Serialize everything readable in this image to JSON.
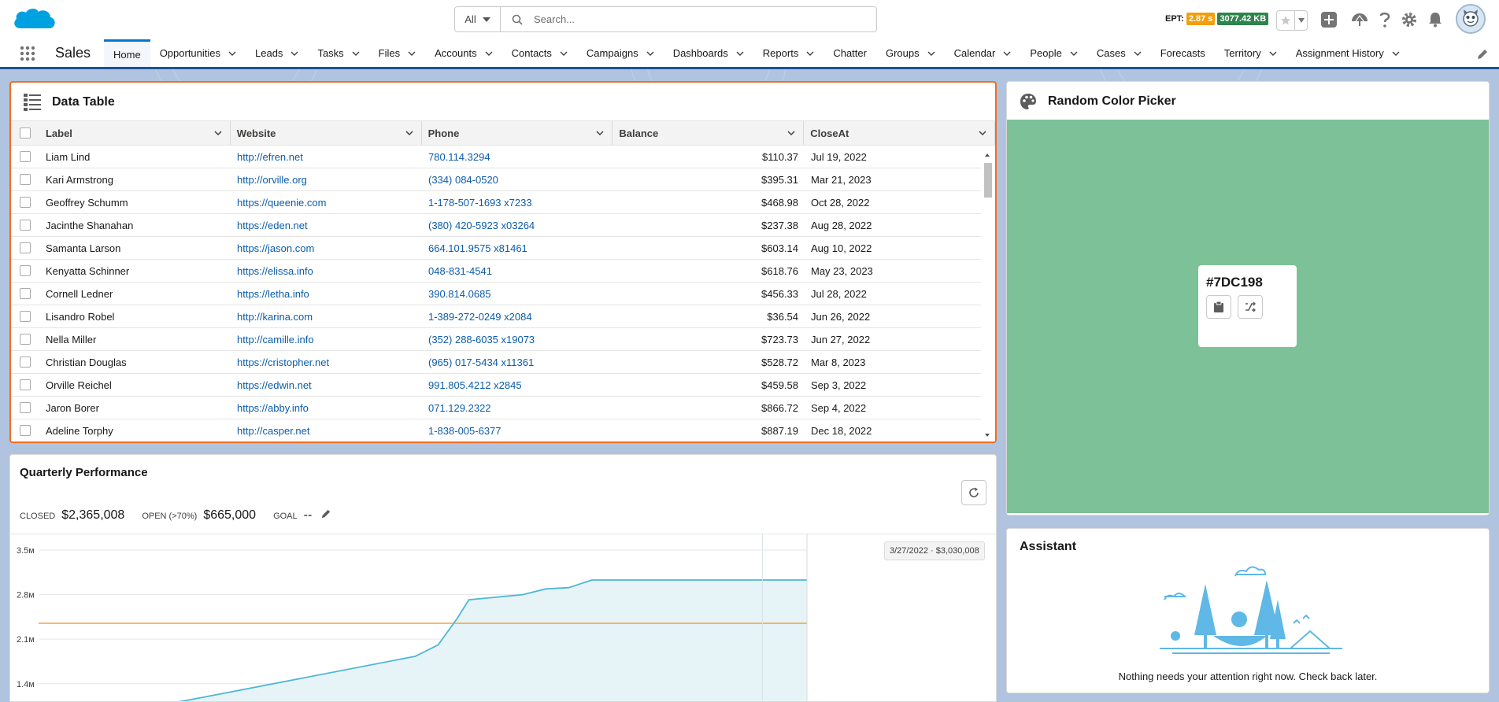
{
  "header": {
    "search_scope": "All",
    "search_placeholder": "Search...",
    "ept_label": "EPT:",
    "ept_time": "2.87 s",
    "ept_size": "3077.42 KB"
  },
  "nav": {
    "app_name": "Sales",
    "items": [
      {
        "label": "Home",
        "active": true,
        "has_menu": false
      },
      {
        "label": "Opportunities",
        "has_menu": true
      },
      {
        "label": "Leads",
        "has_menu": true
      },
      {
        "label": "Tasks",
        "has_menu": true
      },
      {
        "label": "Files",
        "has_menu": true
      },
      {
        "label": "Accounts",
        "has_menu": true
      },
      {
        "label": "Contacts",
        "has_menu": true
      },
      {
        "label": "Campaigns",
        "has_menu": true
      },
      {
        "label": "Dashboards",
        "has_menu": true
      },
      {
        "label": "Reports",
        "has_menu": true
      },
      {
        "label": "Chatter",
        "has_menu": false
      },
      {
        "label": "Groups",
        "has_menu": true
      },
      {
        "label": "Calendar",
        "has_menu": true
      },
      {
        "label": "People",
        "has_menu": true
      },
      {
        "label": "Cases",
        "has_menu": true
      },
      {
        "label": "Forecasts",
        "has_menu": false
      },
      {
        "label": "Territory",
        "has_menu": true
      },
      {
        "label": "Assignment History",
        "has_menu": true
      }
    ]
  },
  "data_table": {
    "title": "Data Table",
    "columns": [
      "Label",
      "Website",
      "Phone",
      "Balance",
      "CloseAt"
    ],
    "rows": [
      {
        "label": "Liam Lind",
        "website": "http://efren.net",
        "phone": "780.114.3294",
        "balance": "$110.37",
        "close": "Jul 19, 2022"
      },
      {
        "label": "Kari Armstrong",
        "website": "http://orville.org",
        "phone": "(334) 084-0520",
        "balance": "$395.31",
        "close": "Mar 21, 2023"
      },
      {
        "label": "Geoffrey Schumm",
        "website": "https://queenie.com",
        "phone": "1-178-507-1693 x7233",
        "balance": "$468.98",
        "close": "Oct 28, 2022"
      },
      {
        "label": "Jacinthe Shanahan",
        "website": "https://eden.net",
        "phone": "(380) 420-5923 x03264",
        "balance": "$237.38",
        "close": "Aug 28, 2022"
      },
      {
        "label": "Samanta Larson",
        "website": "https://jason.com",
        "phone": "664.101.9575 x81461",
        "balance": "$603.14",
        "close": "Aug 10, 2022"
      },
      {
        "label": "Kenyatta Schinner",
        "website": "https://elissa.info",
        "phone": "048-831-4541",
        "balance": "$618.76",
        "close": "May 23, 2023"
      },
      {
        "label": "Cornell Ledner",
        "website": "https://letha.info",
        "phone": "390.814.0685",
        "balance": "$456.33",
        "close": "Jul 28, 2022"
      },
      {
        "label": "Lisandro Robel",
        "website": "http://karina.com",
        "phone": "1-389-272-0249 x2084",
        "balance": "$36.54",
        "close": "Jun 26, 2022"
      },
      {
        "label": "Nella Miller",
        "website": "http://camille.info",
        "phone": "(352) 288-6035 x19073",
        "balance": "$723.73",
        "close": "Jun 27, 2022"
      },
      {
        "label": "Christian Douglas",
        "website": "https://cristopher.net",
        "phone": "(965) 017-5434 x11361",
        "balance": "$528.72",
        "close": "Mar 8, 2023"
      },
      {
        "label": "Orville Reichel",
        "website": "https://edwin.net",
        "phone": "991.805.4212 x2845",
        "balance": "$459.58",
        "close": "Sep 3, 2022"
      },
      {
        "label": "Jaron Borer",
        "website": "https://abby.info",
        "phone": "071.129.2322",
        "balance": "$866.72",
        "close": "Sep 4, 2022"
      },
      {
        "label": "Adeline Torphy",
        "website": "http://casper.net",
        "phone": "1-838-005-6377",
        "balance": "$887.19",
        "close": "Dec 18, 2022"
      }
    ]
  },
  "color_picker": {
    "title": "Random Color Picker",
    "hex": "#7DC198",
    "color": "#7dc198"
  },
  "performance": {
    "title": "Quarterly Performance",
    "closed_label": "CLOSED",
    "closed_value": "$2,365,008",
    "open_label": "OPEN (>70%)",
    "open_value": "$665,000",
    "goal_label": "GOAL",
    "goal_value": "--",
    "tooltip": "3/27/2022 · $3,030,008"
  },
  "chart_data": {
    "type": "area",
    "y_ticks": [
      "3.5м",
      "2.8м",
      "2.1м",
      "1.4м"
    ],
    "tick_values": [
      3.5,
      2.8,
      2.1,
      1.4
    ],
    "ylim_view": [
      1.1,
      3.76
    ],
    "goal_line": 2.35,
    "series": [
      {
        "values": [
          [
            0.0,
            0.7
          ],
          [
            0.22,
            1.2
          ],
          [
            0.49,
            1.83
          ],
          [
            0.52,
            2.01
          ],
          [
            0.545,
            2.43
          ],
          [
            0.56,
            2.72
          ],
          [
            0.63,
            2.8
          ],
          [
            0.66,
            2.89
          ],
          [
            0.69,
            2.91
          ],
          [
            0.72,
            3.03
          ],
          [
            1.0,
            3.03
          ]
        ]
      }
    ],
    "tooltip_x": 0.942
  },
  "assistant": {
    "title": "Assistant",
    "message": "Nothing needs your attention right now. Check back later."
  }
}
